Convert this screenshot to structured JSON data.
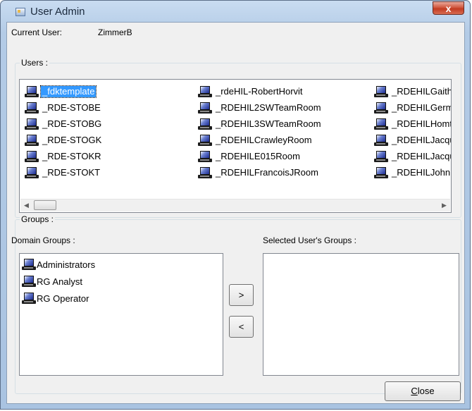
{
  "window": {
    "title": "User Admin",
    "close_glyph": "x"
  },
  "current_user": {
    "label": "Current User:",
    "value": "ZimmerB"
  },
  "users": {
    "group_label": "Users :",
    "items": [
      {
        "label": "_fdktemplate",
        "selected": true,
        "icon": "user-computer-icon"
      },
      {
        "label": "_RDE-STOBE",
        "icon": "user-computer-icon"
      },
      {
        "label": "_RDE-STOBG",
        "icon": "user-computer-icon"
      },
      {
        "label": "_RDE-STOGK",
        "icon": "user-computer-icon"
      },
      {
        "label": "_RDE-STOKR",
        "icon": "user-computer-icon"
      },
      {
        "label": "_RDE-STOKT",
        "icon": "user-computer-icon"
      },
      {
        "label": "_rdeHIL-RobertHorvit",
        "icon": "user-computer-icon"
      },
      {
        "label": "_RDEHIL2SWTeamRoom",
        "icon": "user-computer-icon"
      },
      {
        "label": "_RDEHIL3SWTeamRoom",
        "icon": "user-computer-icon"
      },
      {
        "label": "_RDEHILCrawleyRoom",
        "icon": "user-computer-icon"
      },
      {
        "label": "_RDEHILE015Room",
        "icon": "user-computer-icon"
      },
      {
        "label": "_RDEHILFrancoisJRoom",
        "icon": "user-computer-icon"
      },
      {
        "label": "_RDEHILGaith",
        "icon": "user-computer-icon"
      },
      {
        "label": "_RDEHILGerm",
        "icon": "user-computer-icon"
      },
      {
        "label": "_RDEHILHomt",
        "icon": "user-computer-icon"
      },
      {
        "label": "_RDEHILJacqu",
        "icon": "user-computer-icon"
      },
      {
        "label": "_RDEHILJacqu",
        "icon": "user-computer-icon"
      },
      {
        "label": "_RDEHILJohn",
        "icon": "user-computer-icon"
      }
    ],
    "scroll_left_glyph": "◀",
    "scroll_right_glyph": "▶"
  },
  "groups": {
    "group_label": "Groups :",
    "domain_label": "Domain Groups :",
    "selected_label": "Selected User's Groups :",
    "domain_items": [
      {
        "label": "Administrators",
        "icon": "group-computer-icon"
      },
      {
        "label": "RG Analyst",
        "icon": "group-computer-icon"
      },
      {
        "label": "RG Operator",
        "icon": "group-computer-icon"
      }
    ],
    "selected_items": [],
    "add_button": ">",
    "remove_button": "<"
  },
  "footer": {
    "close_button": "Close"
  }
}
